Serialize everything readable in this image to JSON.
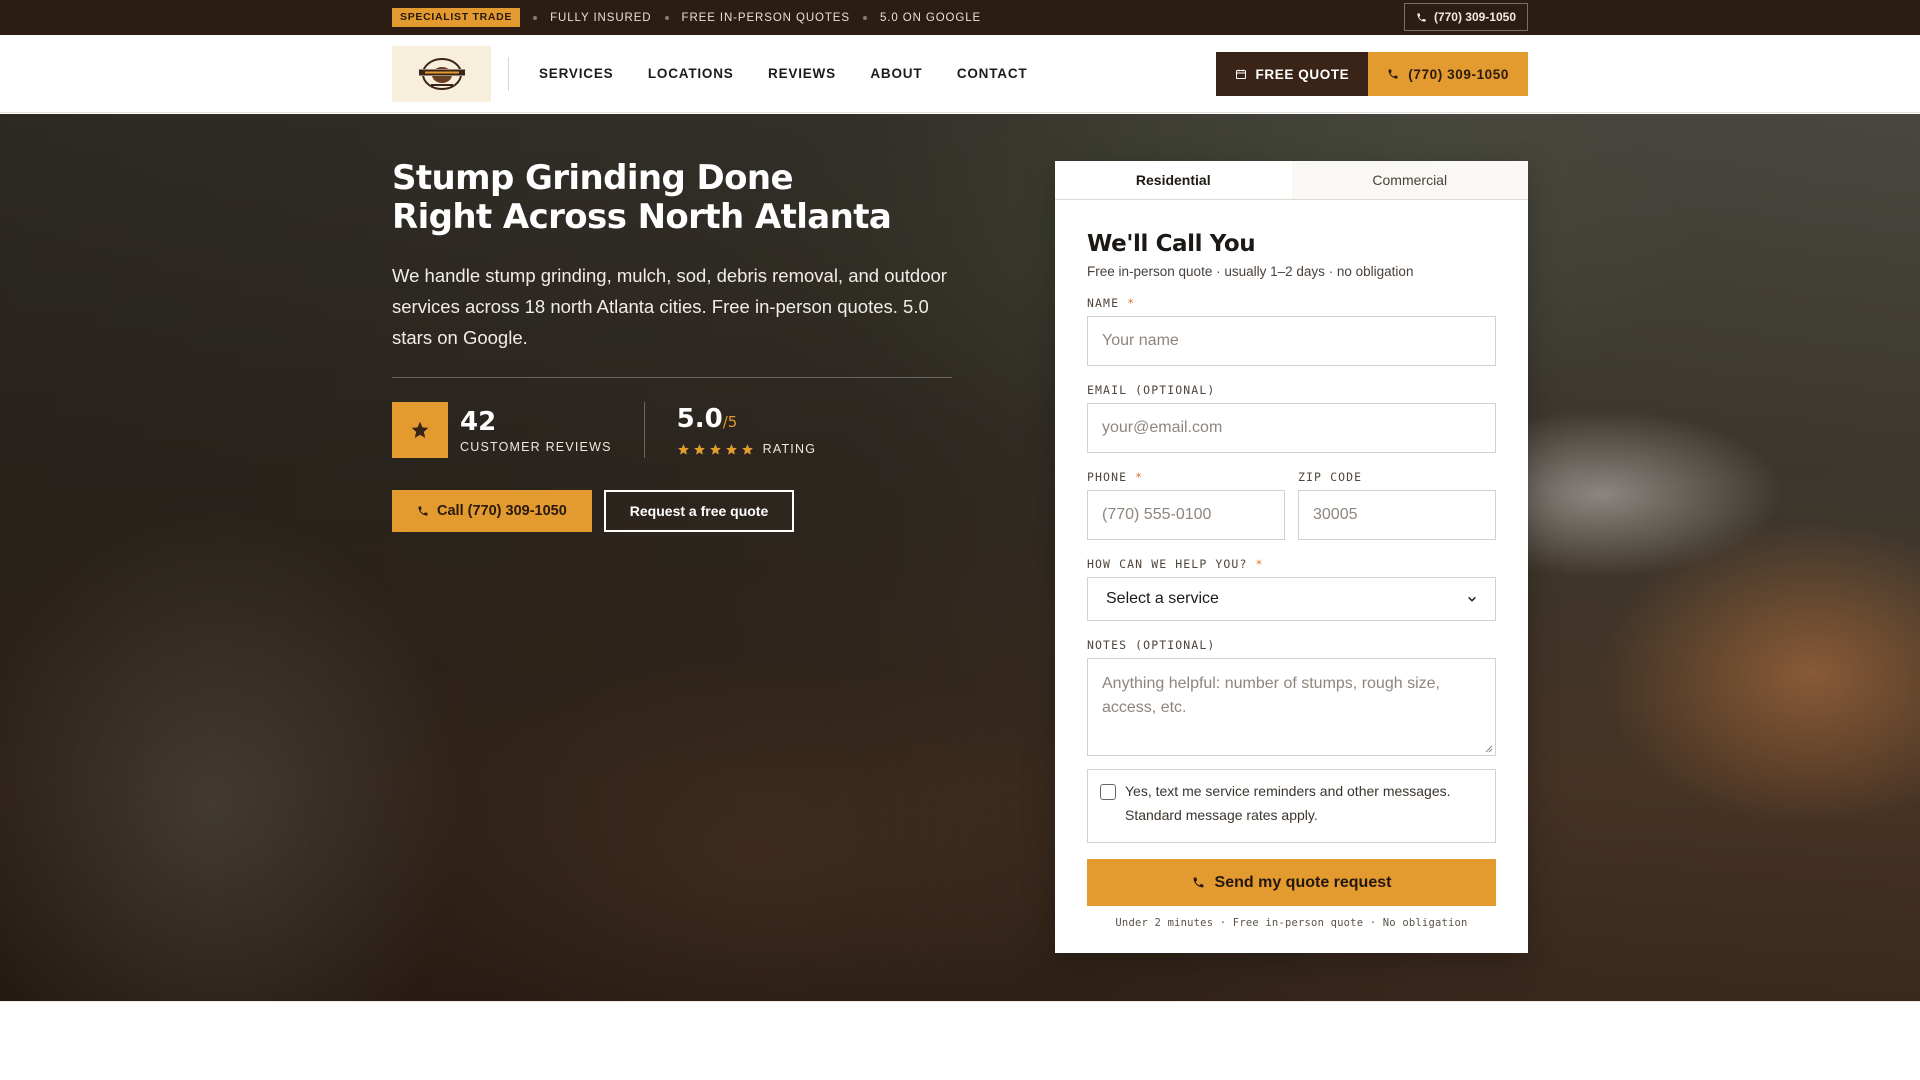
{
  "topbar": {
    "badge": "SPECIALIST TRADE",
    "items": [
      "FULLY INSURED",
      "FREE IN-PERSON QUOTES",
      "5.0 ON GOOGLE"
    ],
    "phone": "(770) 309-1050"
  },
  "header": {
    "logo_alt": "Stump Grinding logo",
    "nav": [
      "SERVICES",
      "LOCATIONS",
      "REVIEWS",
      "ABOUT",
      "CONTACT"
    ],
    "quote_button": "FREE QUOTE",
    "phone_button": "(770) 309-1050"
  },
  "hero": {
    "title_line1": "Stump Grinding Done",
    "title_line2": "Right Across North Atlanta",
    "subtitle": "We handle stump grinding, mulch, sod, debris removal, and outdoor services across 18 north Atlanta cities. Free in-person quotes. 5.0 stars on Google.",
    "reviews_count": "42",
    "reviews_label": "CUSTOMER REVIEWS",
    "rating_value": "5.0",
    "rating_scale": "/5",
    "rating_stars": 5,
    "rating_label": "RATING",
    "call_button": "Call (770) 309-1050",
    "quote_button": "Request a free quote"
  },
  "form": {
    "tabs": [
      "Residential",
      "Commercial"
    ],
    "active_tab": "Residential",
    "title": "We'll Call You",
    "subtitle": "Free in-person quote · usually 1–2 days · no obligation",
    "name_label": "NAME",
    "name_placeholder": "Your name",
    "email_label": "EMAIL (OPTIONAL)",
    "email_placeholder": "your@email.com",
    "phone_label": "PHONE",
    "phone_placeholder": "(770) 555-0100",
    "zip_label": "ZIP CODE",
    "zip_placeholder": "30005",
    "help_label": "HOW CAN WE HELP YOU?",
    "help_selected": "Select a service",
    "notes_label": "NOTES (OPTIONAL)",
    "notes_placeholder": "Anything helpful: number of stumps, rough size, access, etc.",
    "consent_text": "Yes, text me service reminders and other messages. Standard message rates apply.",
    "submit_label": "Send my quote request",
    "fine_print": "Under 2 minutes · Free in-person quote · No obligation",
    "required_marker": "*"
  },
  "colors": {
    "accent": "#e39a2e",
    "dark_brown": "#2c1d14",
    "button_brown": "#3a2418"
  },
  "icons": [
    "phone-icon",
    "calendar-icon",
    "star-icon",
    "chevron-down-icon",
    "resize-grip-icon"
  ]
}
